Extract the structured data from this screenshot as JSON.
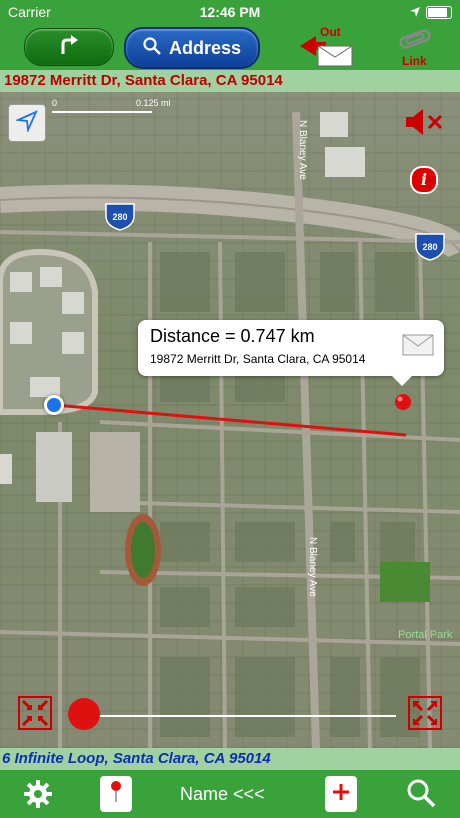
{
  "status_bar": {
    "carrier": "Carrier",
    "time": "12:46 PM"
  },
  "toolbar": {
    "address_label": "Address",
    "out_label": "Out",
    "link_label": "Link"
  },
  "top_address": "19872 Merritt Dr, Santa Clara, CA 95014",
  "map": {
    "scale_zero": "0",
    "scale_value": "0.125 mi",
    "labels": [
      "N Blaney Ave",
      "280",
      "280",
      "N Blaney Ave",
      "Portal Park"
    ]
  },
  "callout": {
    "distance": "Distance = 0.747 km",
    "address": "19872 Merritt Dr, Santa Clara, CA 95014"
  },
  "bottom_address": "6 Infinite Loop, Santa Clara, CA 95014",
  "bottom_bar": {
    "name_label": "Name <<<"
  },
  "colors": {
    "bar_green": "#3aa23a",
    "address_blue": "#0d3f97",
    "route_red": "#e01010"
  }
}
